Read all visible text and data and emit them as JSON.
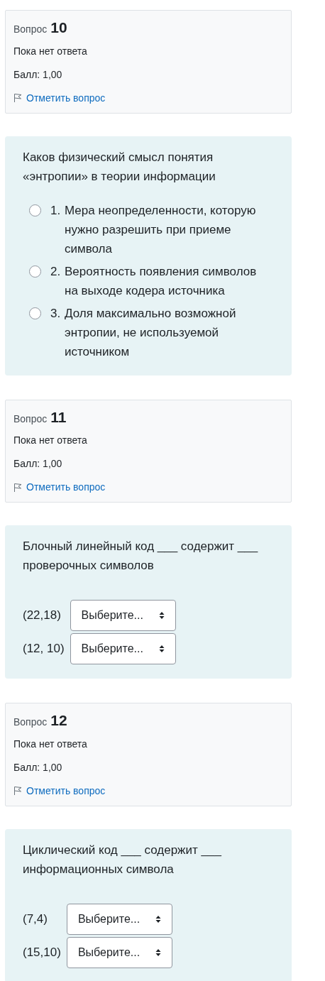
{
  "questions": [
    {
      "label": "Вопрос",
      "number": "10",
      "state": "Пока нет ответа",
      "grade": "Балл: 1,00",
      "flag": "Отметить вопрос",
      "body": {
        "kind": "multichoice",
        "text": "Каков физический смысл понятия «энтропии» в теории информации",
        "options": [
          {
            "number": "1.",
            "text": "Мера неопределенности, которую нужно разрешить при приеме символа",
            "selected": false
          },
          {
            "number": "2.",
            "text": "Вероятность появления символов на выходе кодера источника",
            "selected": false
          },
          {
            "number": "3.",
            "text": "Доля максимально возможной энтропии, не используемой источником",
            "selected": false
          }
        ]
      }
    },
    {
      "label": "Вопрос",
      "number": "11",
      "state": "Пока нет ответа",
      "grade": "Балл: 1,00",
      "flag": "Отметить вопрос",
      "body": {
        "kind": "match",
        "text": "Блочный линейный код ___ содержит ___ проверочных символов",
        "rows": [
          {
            "label": "(22,18)",
            "value": "Выберите..."
          },
          {
            "label": "(12, 10)",
            "value": "Выберите..."
          }
        ]
      }
    },
    {
      "label": "Вопрос",
      "number": "12",
      "state": "Пока нет ответа",
      "grade": "Балл: 1,00",
      "flag": "Отметить вопрос",
      "body": {
        "kind": "match",
        "text": "Циклический код ___ содержит ___ информационных символа",
        "rows": [
          {
            "label": "(7,4)",
            "value": "Выберите..."
          },
          {
            "label": "(15,10)",
            "value": "Выберите..."
          }
        ]
      }
    }
  ]
}
